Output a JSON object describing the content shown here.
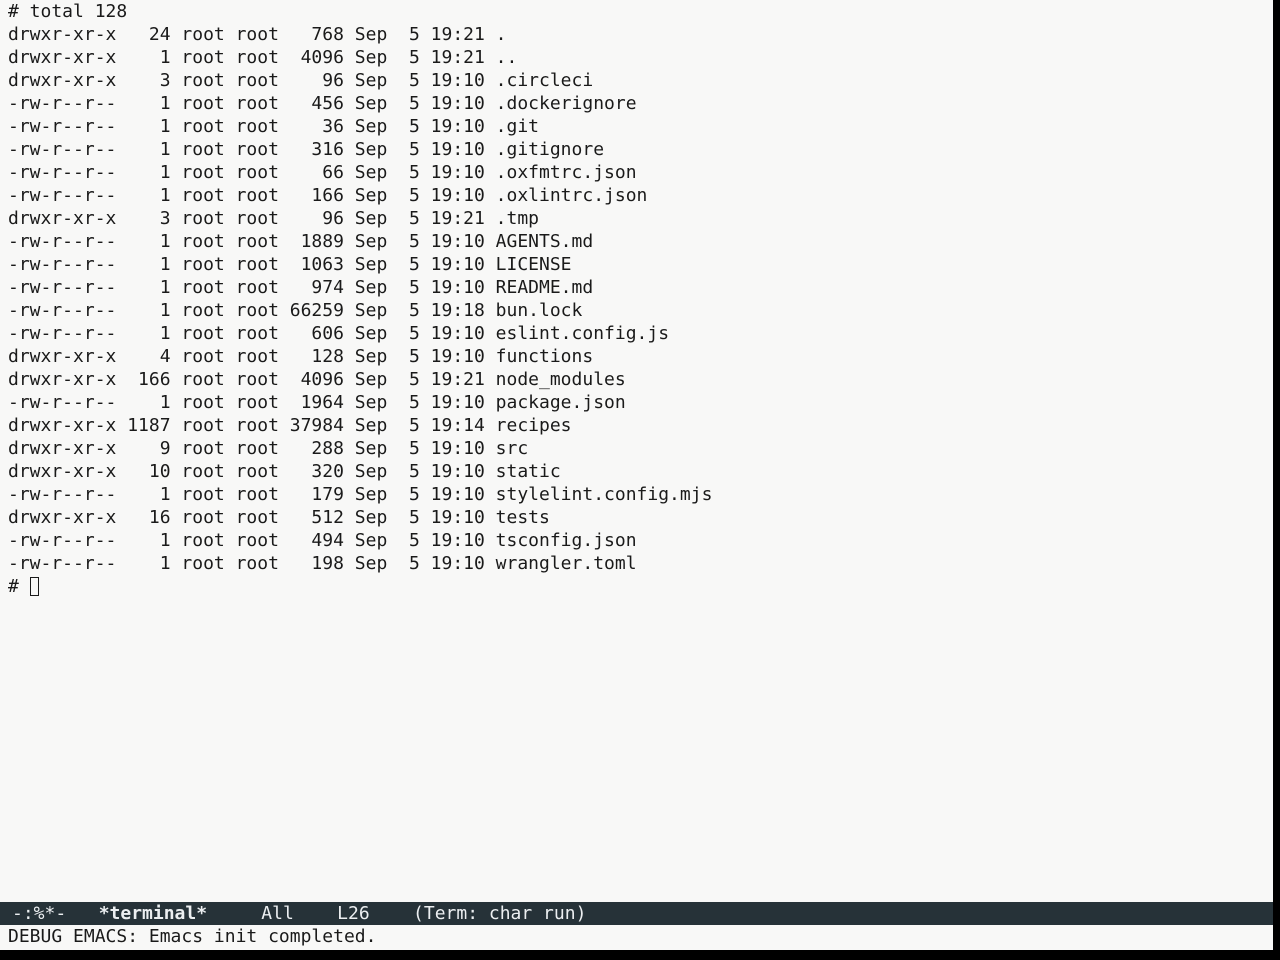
{
  "terminal": {
    "total_line": "# total 128",
    "listing": [
      "drwxr-xr-x   24 root root   768 Sep  5 19:21 .",
      "drwxr-xr-x    1 root root  4096 Sep  5 19:21 ..",
      "drwxr-xr-x    3 root root    96 Sep  5 19:10 .circleci",
      "-rw-r--r--    1 root root   456 Sep  5 19:10 .dockerignore",
      "-rw-r--r--    1 root root    36 Sep  5 19:10 .git",
      "-rw-r--r--    1 root root   316 Sep  5 19:10 .gitignore",
      "-rw-r--r--    1 root root    66 Sep  5 19:10 .oxfmtrc.json",
      "-rw-r--r--    1 root root   166 Sep  5 19:10 .oxlintrc.json",
      "drwxr-xr-x    3 root root    96 Sep  5 19:21 .tmp",
      "-rw-r--r--    1 root root  1889 Sep  5 19:10 AGENTS.md",
      "-rw-r--r--    1 root root  1063 Sep  5 19:10 LICENSE",
      "-rw-r--r--    1 root root   974 Sep  5 19:10 README.md",
      "-rw-r--r--    1 root root 66259 Sep  5 19:18 bun.lock",
      "-rw-r--r--    1 root root   606 Sep  5 19:10 eslint.config.js",
      "drwxr-xr-x    4 root root   128 Sep  5 19:10 functions",
      "drwxr-xr-x  166 root root  4096 Sep  5 19:21 node_modules",
      "-rw-r--r--    1 root root  1964 Sep  5 19:10 package.json",
      "drwxr-xr-x 1187 root root 37984 Sep  5 19:14 recipes",
      "drwxr-xr-x    9 root root   288 Sep  5 19:10 src",
      "drwxr-xr-x   10 root root   320 Sep  5 19:10 static",
      "-rw-r--r--    1 root root   179 Sep  5 19:10 stylelint.config.mjs",
      "drwxr-xr-x   16 root root   512 Sep  5 19:10 tests",
      "-rw-r--r--    1 root root   494 Sep  5 19:10 tsconfig.json",
      "-rw-r--r--    1 root root   198 Sep  5 19:10 wrangler.toml"
    ],
    "prompt": "# "
  },
  "mode_line": {
    "status": "-:%*-",
    "buffer_name": "*terminal*",
    "position": "All",
    "line": "L26",
    "mode": "(Term: char run)"
  },
  "minibuffer": {
    "message": "DEBUG EMACS: Emacs init completed."
  },
  "colors": {
    "background": "#f8f8f7",
    "mode_line_bg": "#263238",
    "mode_line_fg": "#eceff1"
  }
}
